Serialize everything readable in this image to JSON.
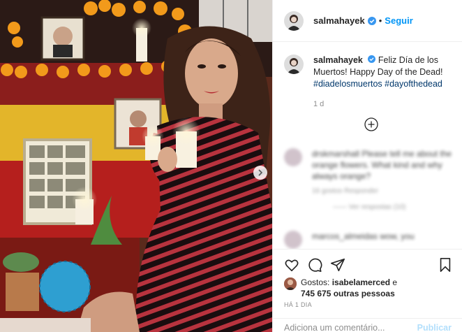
{
  "post": {
    "username": "salmahayek",
    "follow_label": "Seguir",
    "separator": "•",
    "caption_user": "salmahayek",
    "caption_text": "Feliz Día de los Muertos! Happy Day of the Dead!",
    "hashtags": [
      "#diadelosmuertos",
      "#dayofthedead"
    ],
    "caption_time": "1 d"
  },
  "blurred_comments": [
    {
      "text": "drskmarshall Please tell me about the orange flowers. What kind and why always orange?",
      "meta": "16 gostos   Responder",
      "replies": "—— Ver respostas (10)"
    },
    {
      "text": "marcos_almeidas wow, you",
      "meta": ""
    }
  ],
  "likes": {
    "prefix": "Gostos: ",
    "user": "isabelamerced",
    "conjunction": " e",
    "count": "745 675 outras pessoas"
  },
  "posted_ago": "HÁ 1 DIA",
  "comment_placeholder": "Adiciona um comentário...",
  "publish_label": "Publicar",
  "icons": {
    "like": "heart-icon",
    "comment": "comment-icon",
    "share": "share-icon",
    "save": "bookmark-icon",
    "next": "chevron-right-icon",
    "load_more": "plus-circle-icon"
  },
  "colors": {
    "link": "#0095f6",
    "hashtag": "#00376b",
    "muted": "#8e8e8e",
    "publish": "#b2dffc"
  }
}
